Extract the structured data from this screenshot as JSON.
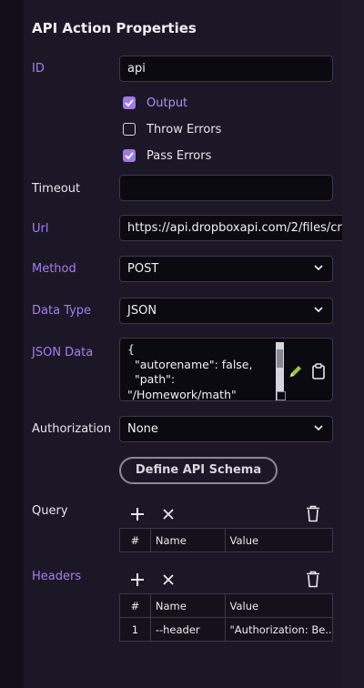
{
  "panel": {
    "title": "API Action Properties",
    "id": {
      "label": "ID",
      "value": "api"
    },
    "checkboxes": [
      {
        "label": "Output",
        "checked": true
      },
      {
        "label": "Throw Errors",
        "checked": false
      },
      {
        "label": "Pass Errors",
        "checked": true
      }
    ],
    "timeout": {
      "label": "Timeout",
      "value": ""
    },
    "url": {
      "label": "Url",
      "value": "https://api.dropboxapi.com/2/files/cre"
    },
    "method": {
      "label": "Method",
      "value": "POST"
    },
    "data_type": {
      "label": "Data Type",
      "value": "JSON"
    },
    "json_data": {
      "label": "JSON Data",
      "value": "{\n  \"autorename\": false,\n  \"path\":\n\"/Homework/math\""
    },
    "authorization": {
      "label": "Authorization",
      "value": "None"
    },
    "define_schema_label": "Define API Schema",
    "query": {
      "label": "Query",
      "columns": [
        "#",
        "Name",
        "Value"
      ],
      "rows": []
    },
    "headers": {
      "label": "Headers",
      "columns": [
        "#",
        "Name",
        "Value"
      ],
      "rows": [
        {
          "num": "1",
          "name": "--header",
          "value": "\"Authorization: Be..."
        }
      ]
    }
  },
  "colors": {
    "accent": "#a57cf0",
    "background": "#1c1727",
    "input_bg": "#0c0a11"
  },
  "icons": [
    "checkmark-icon",
    "chevron-down-icon",
    "pencil-icon",
    "clipboard-icon",
    "plus-icon",
    "close-icon",
    "trash-icon"
  ]
}
